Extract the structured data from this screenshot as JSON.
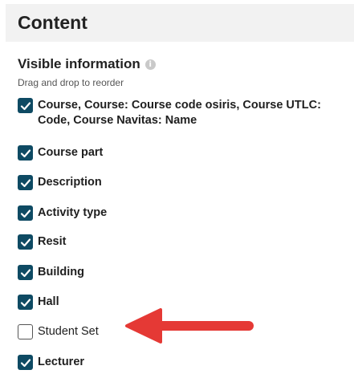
{
  "header": {
    "title": "Content"
  },
  "section": {
    "title": "Visible information",
    "info_icon": "info-icon",
    "hint": "Drag and drop to reorder"
  },
  "items": [
    {
      "label": "Course, Course: Course code osiris, Course UTLC: Code, Course Navitas: Name",
      "checked": true
    },
    {
      "label": "Course part",
      "checked": true
    },
    {
      "label": "Description",
      "checked": true
    },
    {
      "label": "Activity type",
      "checked": true
    },
    {
      "label": "Resit",
      "checked": true
    },
    {
      "label": "Building",
      "checked": true
    },
    {
      "label": "Hall",
      "checked": true
    },
    {
      "label": "Student Set",
      "checked": false
    },
    {
      "label": "Lecturer",
      "checked": true
    }
  ],
  "colors": {
    "checkbox_checked": "#0e4a63",
    "arrow": "#e53935",
    "header_bg": "#f2f2f2"
  }
}
